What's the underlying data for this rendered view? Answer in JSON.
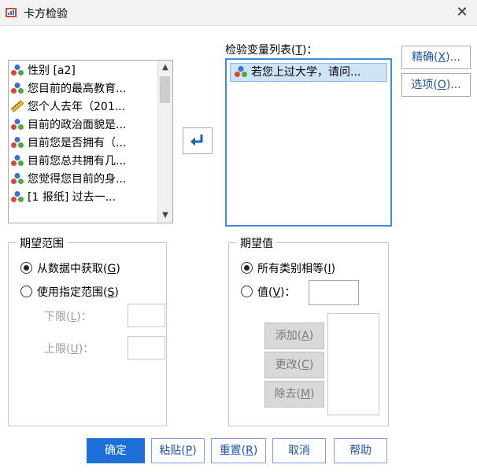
{
  "window": {
    "title": "卡方检验",
    "close_glyph": "✕"
  },
  "source_list": {
    "items": [
      {
        "label": "性别 [a2]",
        "icon": "nominal-variable-icon"
      },
      {
        "label": "您目前的最高教育...",
        "icon": "nominal-variable-icon"
      },
      {
        "label": "您个人去年（201...",
        "icon": "scale-variable-icon"
      },
      {
        "label": "目前的政治面貌是...",
        "icon": "nominal-variable-icon"
      },
      {
        "label": "目前您是否拥有（...",
        "icon": "nominal-variable-icon"
      },
      {
        "label": "目前您总共拥有几...",
        "icon": "nominal-variable-icon"
      },
      {
        "label": "您觉得您目前的身...",
        "icon": "nominal-variable-icon"
      },
      {
        "label": "[1 报纸]  过去一...",
        "icon": "nominal-variable-icon"
      }
    ]
  },
  "test_vars": {
    "label": "检验变量列表(",
    "label_key": "T",
    "label_tail": ")：",
    "items": [
      {
        "label": "若您上过大学，请问...",
        "icon": "nominal-variable-icon"
      }
    ]
  },
  "side_buttons": {
    "exact": {
      "pre": "精确(",
      "key": "X",
      "post": ")..."
    },
    "options": {
      "pre": "选项(",
      "key": "O",
      "post": ")..."
    }
  },
  "expected_range": {
    "title": "期望范围",
    "from_data": {
      "pre": "从数据中获取(",
      "key": "G",
      "post": ")",
      "selected": true
    },
    "use_range": {
      "pre": "使用指定范围(",
      "key": "S",
      "post": ")",
      "selected": false
    },
    "lower": {
      "pre": "下限(",
      "key": "L",
      "post": ")："
    },
    "upper": {
      "pre": "上限(",
      "key": "U",
      "post": ")："
    }
  },
  "expected_values": {
    "title": "期望值",
    "all_equal": {
      "pre": "所有类别相等(",
      "key": "I",
      "post": ")",
      "selected": true
    },
    "values": {
      "pre": "值(",
      "key": "V",
      "post": ")：",
      "selected": false
    },
    "add": {
      "pre": "添加(",
      "key": "A",
      "post": ")"
    },
    "change": {
      "pre": "更改(",
      "key": "C",
      "post": ")"
    },
    "remove": {
      "pre": "除去(",
      "key": "M",
      "post": ")"
    }
  },
  "bottom_buttons": {
    "ok": "确定",
    "paste": {
      "pre": "粘贴(",
      "key": "P",
      "post": ")"
    },
    "reset": {
      "pre": "重置(",
      "key": "R",
      "post": ")"
    },
    "cancel": "取消",
    "help": "帮助"
  },
  "colors": {
    "accent": "#1f6fd8",
    "selection": "#cfe3f7",
    "focus_border": "#3b8ddb"
  }
}
